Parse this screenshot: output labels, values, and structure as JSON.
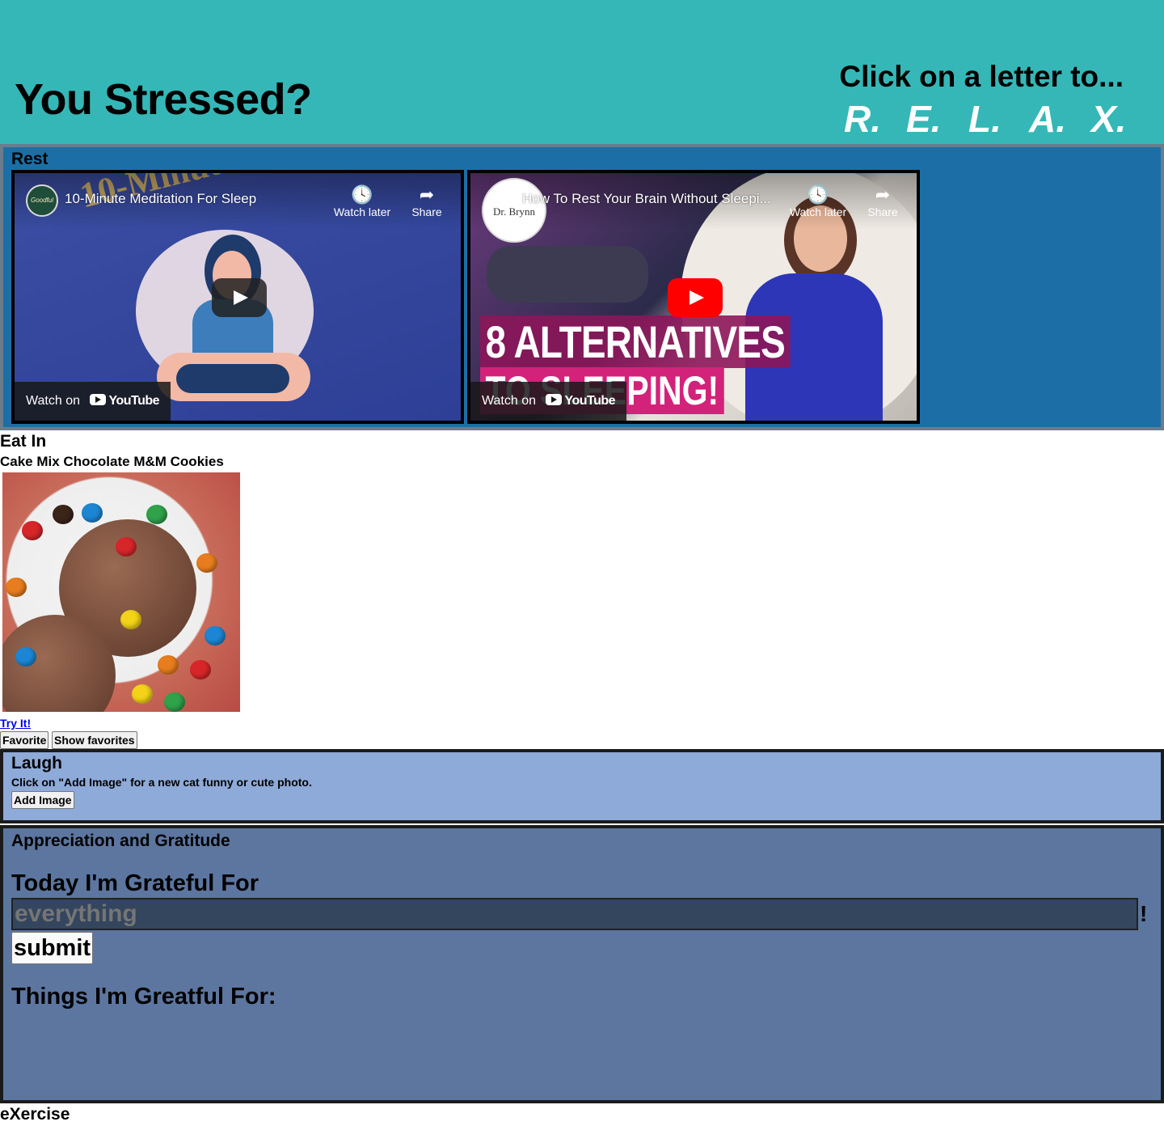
{
  "header": {
    "title": "You Stressed?",
    "prompt": "Click on a letter to...",
    "letters": [
      "R.",
      "E.",
      "L.",
      "A.",
      "X."
    ]
  },
  "rest": {
    "title": "Rest",
    "videos": [
      {
        "title": "10-Minute Meditation For Sleep",
        "channel_avatar": "Goodful",
        "overlay": "10-Minute Meditation",
        "watch_later": "Watch later",
        "share": "Share",
        "watch_on": "Watch on",
        "youtube": "YouTube"
      },
      {
        "title": "How To Rest Your Brain Without Sleepi...",
        "channel_avatar": "Dr. Brynn",
        "overlay_line1": "8 ALTERNATIVES",
        "overlay_line2": "TO SLEEPING!",
        "watch_later": "Watch later",
        "share": "Share",
        "watch_on": "Watch on",
        "youtube": "YouTube"
      }
    ]
  },
  "eat": {
    "title": "Eat In",
    "recipe_name": "Cake Mix Chocolate M&M Cookies",
    "try_link": "Try It!",
    "favorite_button": "Favorite",
    "show_favorites_button": "Show favorites"
  },
  "laugh": {
    "title": "Laugh",
    "hint": "Click on \"Add Image\" for a new cat funny or cute photo.",
    "add_image_button": "Add Image"
  },
  "gratitude": {
    "title": "Appreciation and Gratitude",
    "heading": "Today I'm Grateful For",
    "input_placeholder": "everything",
    "exclamation": "!",
    "submit_button": "submit",
    "list_heading": "Things I'm Greatful For:"
  },
  "exercise": {
    "title": "eXercise"
  },
  "colors": {
    "header_bg": "#35b7b7",
    "rest_bg": "#1c6fa6",
    "laugh_bg": "#8eaad8",
    "gratitude_bg": "#5c76a0",
    "youtube_red": "#ff0000"
  }
}
